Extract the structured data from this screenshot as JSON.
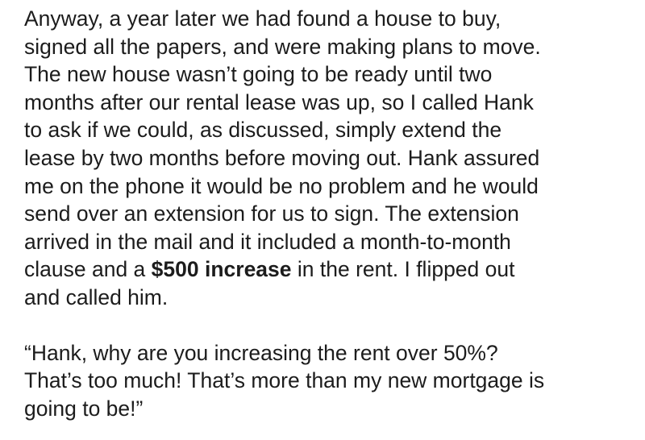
{
  "paragraphs": [
    {
      "lines": [
        "Anyway, a year later we had found a house to buy,",
        "signed all the papers, and were making plans to move.",
        "The new house wasn’t going to be ready until two",
        "months after our rental lease was up, so I called Hank",
        "to ask if we could, as discussed, simply extend the",
        "lease by two months before moving out. Hank assured",
        "me on the phone it would be no problem and he would",
        "send over an extension for us to sign. The extension",
        "arrived in the mail and it included a month-to-month"
      ],
      "line10": {
        "before": "clause and a ",
        "bold": "$500 increase",
        "after": " in the rent. I flipped out"
      },
      "line11": "and called him."
    },
    {
      "lines": [
        "“Hank, why are you increasing the rent over 50%?",
        "That’s too much! That’s more than my new mortgage is",
        "going to be!”"
      ]
    }
  ]
}
